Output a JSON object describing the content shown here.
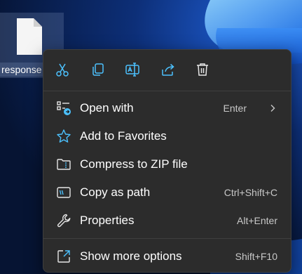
{
  "desktop": {
    "file": {
      "name": "response",
      "icon": "file-icon"
    }
  },
  "context_menu": {
    "toolbar": [
      {
        "icon": "cut-icon",
        "name": "cut-button"
      },
      {
        "icon": "copy-icon",
        "name": "copy-button"
      },
      {
        "icon": "rename-icon",
        "name": "rename-button"
      },
      {
        "icon": "share-icon",
        "name": "share-button"
      },
      {
        "icon": "delete-icon",
        "name": "delete-button"
      }
    ],
    "items": [
      {
        "label": "Open with",
        "shortcut": "Enter",
        "icon": "open-with-icon",
        "submenu": true
      },
      {
        "label": "Add to Favorites",
        "shortcut": "",
        "icon": "star-icon"
      },
      {
        "label": "Compress to ZIP file",
        "shortcut": "",
        "icon": "zip-folder-icon"
      },
      {
        "label": "Copy as path",
        "shortcut": "Ctrl+Shift+C",
        "icon": "copy-path-icon"
      },
      {
        "label": "Properties",
        "shortcut": "Alt+Enter",
        "icon": "wrench-icon"
      },
      {
        "label": "Show more options",
        "shortcut": "Shift+F10",
        "icon": "show-more-icon"
      }
    ]
  },
  "colors": {
    "menu_background": "#2c2c2c",
    "accent": "#4cc2ff",
    "text": "#ffffff",
    "shortcut_text": "#c8c8c8"
  }
}
